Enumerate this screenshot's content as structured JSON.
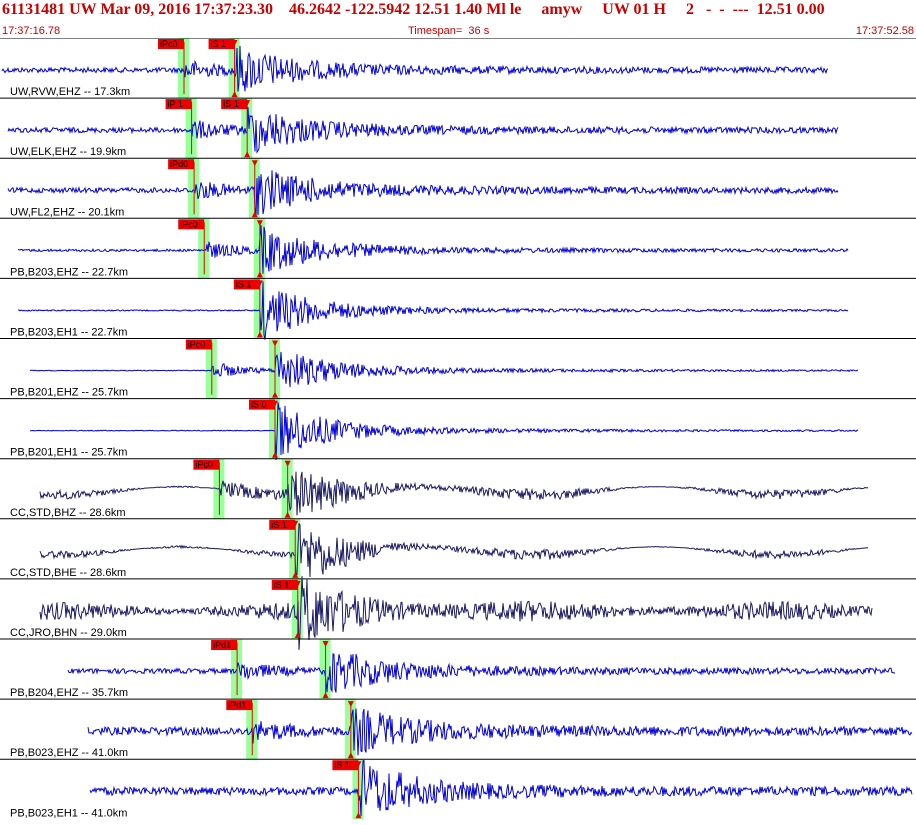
{
  "header": {
    "event_line": "61131481 UW Mar 09, 2016 17:37:23.30    46.2642 -122.5942 12.51 1.40 Ml le     amyw     UW 01 H     2   -  -  ---  12.51 0.00",
    "start_time": "17:37:16.78",
    "timespan": "Timespan=  36 s",
    "end_time": "17:37:52.58"
  },
  "colors": {
    "header_text": "#c80000",
    "trace_blue": "#0000dd",
    "trace_navy": "#1a1a66",
    "pick_flag": "#ee0000",
    "pick_window": "#99ff99"
  },
  "panels": [
    {
      "label": "UW,RVW,EHZ -- 17.3km",
      "color": "trace_blue",
      "picks": [
        {
          "text": "iPc0",
          "t": 7.2,
          "kind": "P"
        },
        {
          "text": "iS 1",
          "t": 9.2,
          "kind": "S"
        }
      ]
    },
    {
      "label": "UW,ELK,EHZ -- 19.9km",
      "color": "trace_blue",
      "picks": [
        {
          "text": "iP 1",
          "t": 7.5,
          "kind": "P"
        },
        {
          "text": "iS 1",
          "t": 9.7,
          "kind": "S"
        }
      ]
    },
    {
      "label": "UW,FL2,EHZ -- 20.1km",
      "color": "trace_blue",
      "picks": [
        {
          "text": "iPd0",
          "t": 7.6,
          "kind": "P"
        },
        {
          "text": "",
          "t": 10.0,
          "kind": "S"
        }
      ]
    },
    {
      "label": "PB,B203,EHZ -- 22.7km",
      "color": "trace_blue",
      "picks": [
        {
          "text": "iPc0",
          "t": 8.0,
          "kind": "P"
        },
        {
          "text": "",
          "t": 10.2,
          "kind": "S"
        }
      ]
    },
    {
      "label": "PB,B203,EH1 -- 22.7km",
      "color": "trace_blue",
      "picks": [
        {
          "text": "iS 1",
          "t": 10.2,
          "kind": "S"
        }
      ]
    },
    {
      "label": "PB,B201,EHZ -- 25.7km",
      "color": "trace_blue",
      "picks": [
        {
          "text": "iPc0",
          "t": 8.3,
          "kind": "P"
        },
        {
          "text": "",
          "t": 10.8,
          "kind": "S"
        }
      ]
    },
    {
      "label": "PB,B201,EH1 -- 25.7km",
      "color": "trace_blue",
      "picks": [
        {
          "text": "iS 0",
          "t": 10.8,
          "kind": "S"
        }
      ]
    },
    {
      "label": "CC,STD,BHZ -- 28.6km",
      "color": "trace_navy",
      "picks": [
        {
          "text": "iPc0",
          "t": 8.6,
          "kind": "P"
        },
        {
          "text": "",
          "t": 11.3,
          "kind": "S"
        }
      ]
    },
    {
      "label": "CC,STD,BHE -- 28.6km",
      "color": "trace_navy",
      "picks": [
        {
          "text": "iS 1",
          "t": 11.6,
          "kind": "S"
        }
      ]
    },
    {
      "label": "CC,JRO,BHN -- 29.0km",
      "color": "trace_navy",
      "picks": [
        {
          "text": "iS 1",
          "t": 11.7,
          "kind": "S"
        }
      ]
    },
    {
      "label": "PB,B204,EHZ -- 35.7km",
      "color": "trace_blue",
      "picks": [
        {
          "text": "iPd1",
          "t": 9.3,
          "kind": "P"
        },
        {
          "text": "",
          "t": 12.8,
          "kind": "S"
        }
      ]
    },
    {
      "label": "PB,B023,EHZ -- 41.0km",
      "color": "trace_blue",
      "picks": [
        {
          "text": "iPd1",
          "t": 9.9,
          "kind": "P"
        },
        {
          "text": "",
          "t": 13.8,
          "kind": "S"
        }
      ]
    },
    {
      "label": "PB,B023,EH1 -- 41.0km",
      "color": "trace_blue",
      "picks": [
        {
          "text": "iS 1",
          "t": 14.1,
          "kind": "S"
        }
      ]
    }
  ]
}
